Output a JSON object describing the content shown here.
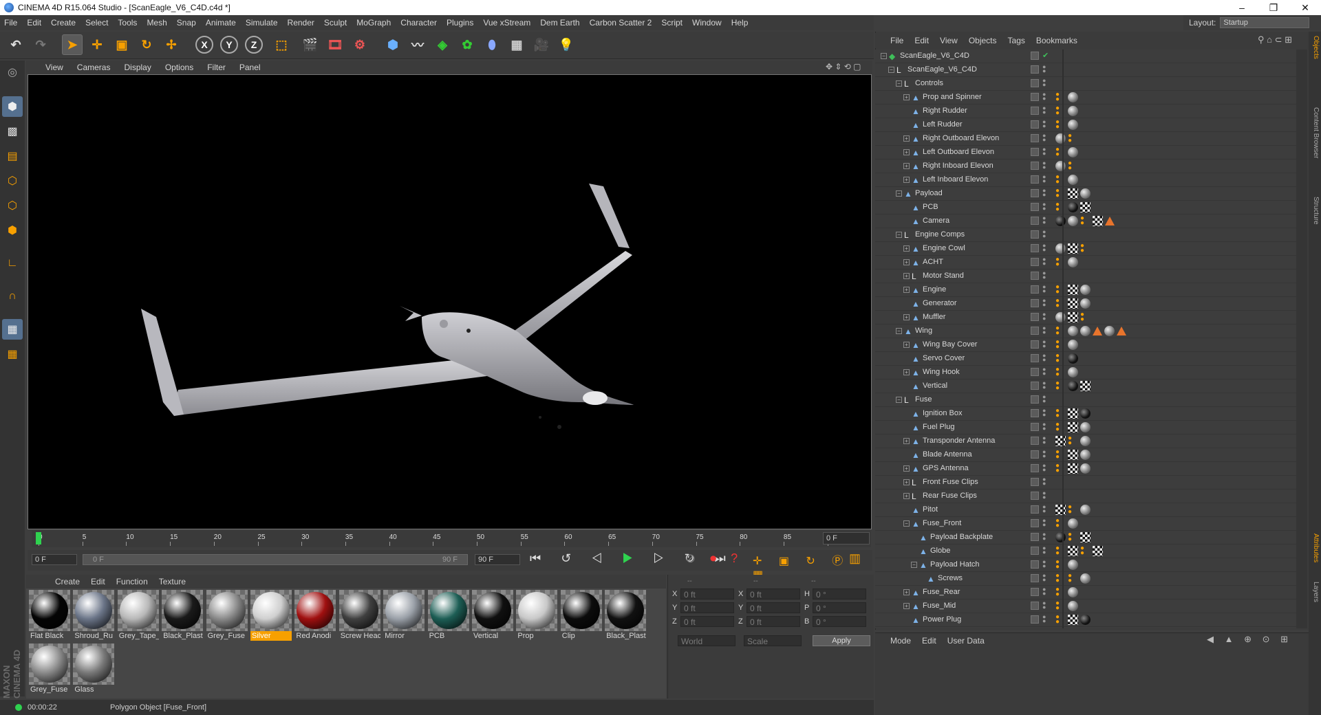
{
  "window": {
    "title": "CINEMA 4D R15.064 Studio - [ScanEagle_V6_C4D.c4d *]"
  },
  "menubar": [
    "File",
    "Edit",
    "Create",
    "Select",
    "Tools",
    "Mesh",
    "Snap",
    "Animate",
    "Simulate",
    "Render",
    "Sculpt",
    "MoGraph",
    "Character",
    "Plugins",
    "Vue xStream",
    "Dem Earth",
    "Carbon Scatter 2",
    "Script",
    "Window",
    "Help"
  ],
  "layout": {
    "label": "Layout:",
    "value": "Startup"
  },
  "viewport_menu": [
    "View",
    "Cameras",
    "Display",
    "Options",
    "Filter",
    "Panel"
  ],
  "timeline": {
    "ticks": [
      "0",
      "5",
      "10",
      "15",
      "20",
      "25",
      "30",
      "35",
      "40",
      "45",
      "50",
      "55",
      "60",
      "65",
      "70",
      "75",
      "80",
      "85",
      "90"
    ],
    "current_frame": "0 F",
    "start": "0 F",
    "range_start": "0 F",
    "range_end": "90 F",
    "end": "90 F"
  },
  "material_menu": [
    "Create",
    "Edit",
    "Function",
    "Texture"
  ],
  "materials": [
    {
      "name": "Flat Black",
      "color": "#050505"
    },
    {
      "name": "Shroud_Ru",
      "color": "#6b7588"
    },
    {
      "name": "Grey_Tape_",
      "color": "#b8b8b8"
    },
    {
      "name": "Black_Plast",
      "color": "#1a1a1a"
    },
    {
      "name": "Grey_Fuse",
      "color": "#8a8a8a"
    },
    {
      "name": "Silver",
      "color": "#cfcfcf",
      "selected": true
    },
    {
      "name": "Red Anodi",
      "color": "#a01010"
    },
    {
      "name": "Screw Heac",
      "color": "#404040"
    },
    {
      "name": "Mirror",
      "color": "#9aa0a8"
    },
    {
      "name": "PCB",
      "color": "#1d5e55"
    },
    {
      "name": "Vertical",
      "color": "#101010"
    },
    {
      "name": "Prop",
      "color": "#c8c8c8"
    },
    {
      "name": "Clip",
      "color": "#0c0c0c"
    },
    {
      "name": "Black_Plast",
      "color": "#111111"
    },
    {
      "name": "Grey_Fuse",
      "color": "#8c8c8c"
    },
    {
      "name": "Glass",
      "color": "#7a7a7a"
    }
  ],
  "coords": {
    "headers": [
      "--",
      "--",
      "--"
    ],
    "rows": [
      {
        "a": "X",
        "av": "0 ft",
        "b": "X",
        "bv": "0 ft",
        "c": "H",
        "cv": "0 °"
      },
      {
        "a": "Y",
        "av": "0 ft",
        "b": "Y",
        "bv": "0 ft",
        "c": "P",
        "cv": "0 °"
      },
      {
        "a": "Z",
        "av": "0 ft",
        "b": "Z",
        "bv": "0 ft",
        "c": "B",
        "cv": "0 °"
      }
    ],
    "mode1": "World",
    "mode2": "Scale",
    "apply": "Apply"
  },
  "status": {
    "time": "00:00:22",
    "message": "Polygon Object [Fuse_Front]"
  },
  "object_menu": [
    "File",
    "Edit",
    "View",
    "Objects",
    "Tags",
    "Bookmarks"
  ],
  "objects": [
    {
      "name": "ScanEagle_V6_C4D",
      "depth": 0,
      "icon": "scene",
      "tags": []
    },
    {
      "name": "ScanEagle_V6_C4D",
      "depth": 1,
      "icon": "null",
      "tags": []
    },
    {
      "name": "Controls",
      "depth": 2,
      "icon": "null",
      "tags": []
    },
    {
      "name": "Prop and Spinner",
      "depth": 3,
      "icon": "poly",
      "tags": [
        "phong",
        "ball"
      ]
    },
    {
      "name": "Right Rudder",
      "depth": 3,
      "icon": "poly",
      "tags": [
        "phong",
        "ball"
      ]
    },
    {
      "name": "Left Rudder",
      "depth": 3,
      "icon": "poly",
      "tags": [
        "phong",
        "ball"
      ]
    },
    {
      "name": "Right Outboard Elevon",
      "depth": 3,
      "icon": "poly",
      "tags": [
        "ball",
        "phong"
      ]
    },
    {
      "name": "Left Outboard Elevon",
      "depth": 3,
      "icon": "poly",
      "tags": [
        "phong",
        "ball"
      ]
    },
    {
      "name": "Right Inboard Elevon",
      "depth": 3,
      "icon": "poly",
      "tags": [
        "ball",
        "phong"
      ]
    },
    {
      "name": "Left Inboard Elevon",
      "depth": 3,
      "icon": "poly",
      "tags": [
        "phong",
        "ball"
      ]
    },
    {
      "name": "Payload",
      "depth": 2,
      "icon": "poly",
      "tags": [
        "phong",
        "chk",
        "ball"
      ]
    },
    {
      "name": "PCB",
      "depth": 3,
      "icon": "poly",
      "tags": [
        "phong",
        "dark",
        "chk"
      ]
    },
    {
      "name": "Camera",
      "depth": 3,
      "icon": "poly",
      "tags": [
        "dark",
        "ball",
        "phong",
        "chk",
        "tri"
      ]
    },
    {
      "name": "Engine Comps",
      "depth": 2,
      "icon": "null",
      "tags": []
    },
    {
      "name": "Engine Cowl",
      "depth": 3,
      "icon": "poly",
      "tags": [
        "ball",
        "chk",
        "phong"
      ]
    },
    {
      "name": "ACHT",
      "depth": 3,
      "icon": "poly",
      "tags": [
        "phong",
        "ball"
      ]
    },
    {
      "name": "Motor Stand",
      "depth": 3,
      "icon": "null",
      "tags": []
    },
    {
      "name": "Engine",
      "depth": 3,
      "icon": "poly",
      "tags": [
        "phong",
        "chk",
        "ball"
      ]
    },
    {
      "name": "Generator",
      "depth": 3,
      "icon": "poly",
      "tags": [
        "phong",
        "chk",
        "ball"
      ]
    },
    {
      "name": "Muffler",
      "depth": 3,
      "icon": "poly",
      "tags": [
        "ball",
        "chk",
        "phong"
      ]
    },
    {
      "name": "Wing",
      "depth": 2,
      "icon": "poly",
      "tags": [
        "phong",
        "ball",
        "ball",
        "tri",
        "ball",
        "tri"
      ]
    },
    {
      "name": "Wing Bay Cover",
      "depth": 3,
      "icon": "poly",
      "tags": [
        "phong",
        "ball"
      ]
    },
    {
      "name": "Servo Cover",
      "depth": 3,
      "icon": "poly",
      "tags": [
        "phong",
        "dark"
      ]
    },
    {
      "name": "Wing Hook",
      "depth": 3,
      "icon": "poly",
      "tags": [
        "phong",
        "ball"
      ]
    },
    {
      "name": "Vertical",
      "depth": 3,
      "icon": "poly",
      "tags": [
        "phong",
        "dark",
        "chk"
      ]
    },
    {
      "name": "Fuse",
      "depth": 2,
      "icon": "null",
      "tags": []
    },
    {
      "name": "Ignition Box",
      "depth": 3,
      "icon": "poly",
      "tags": [
        "phong",
        "chk",
        "dark"
      ]
    },
    {
      "name": "Fuel Plug",
      "depth": 3,
      "icon": "poly",
      "tags": [
        "phong",
        "chk",
        "ball"
      ]
    },
    {
      "name": "Transponder Antenna",
      "depth": 3,
      "icon": "poly",
      "tags": [
        "chk",
        "phong",
        "ball"
      ]
    },
    {
      "name": "Blade Antenna",
      "depth": 3,
      "icon": "poly",
      "tags": [
        "phong",
        "chk",
        "ball"
      ]
    },
    {
      "name": "GPS Antenna",
      "depth": 3,
      "icon": "poly",
      "tags": [
        "phong",
        "chk",
        "ball"
      ]
    },
    {
      "name": "Front Fuse Clips",
      "depth": 3,
      "icon": "null",
      "tags": []
    },
    {
      "name": "Rear Fuse Clips",
      "depth": 3,
      "icon": "null",
      "tags": []
    },
    {
      "name": "Pitot",
      "depth": 3,
      "icon": "poly",
      "tags": [
        "chk",
        "phong",
        "ball"
      ]
    },
    {
      "name": "Fuse_Front",
      "depth": 3,
      "icon": "poly",
      "tags": [
        "phong",
        "ball"
      ]
    },
    {
      "name": "Payload Backplate",
      "depth": 4,
      "icon": "poly",
      "tags": [
        "dark",
        "phong",
        "chk"
      ]
    },
    {
      "name": "Globe",
      "depth": 4,
      "icon": "poly",
      "tags": [
        "phong",
        "chk",
        "phong",
        "chk"
      ]
    },
    {
      "name": "Payload Hatch",
      "depth": 4,
      "icon": "poly",
      "tags": [
        "phong",
        "ball"
      ]
    },
    {
      "name": "Screws",
      "depth": 5,
      "icon": "poly",
      "tags": [
        "phong",
        "phong",
        "ball"
      ]
    },
    {
      "name": "Fuse_Rear",
      "depth": 3,
      "icon": "poly",
      "tags": [
        "phong",
        "ball"
      ]
    },
    {
      "name": "Fuse_Mid",
      "depth": 3,
      "icon": "poly",
      "tags": [
        "phong",
        "ball"
      ]
    },
    {
      "name": "Power Plug",
      "depth": 3,
      "icon": "poly",
      "tags": [
        "phong",
        "chk",
        "dark"
      ]
    }
  ],
  "attr_menu": [
    "Mode",
    "Edit",
    "User Data"
  ],
  "right_tabs": [
    "Objects",
    "Content Browser",
    "Structure",
    "Attributes",
    "Layers"
  ],
  "brand": "MAXON CINEMA 4D"
}
